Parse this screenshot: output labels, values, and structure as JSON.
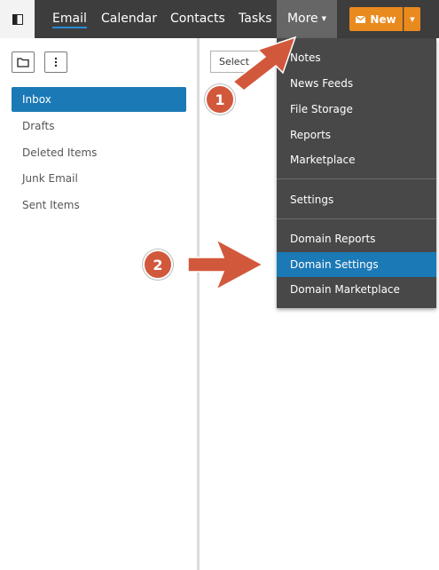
{
  "nav": {
    "email": "Email",
    "calendar": "Calendar",
    "contacts": "Contacts",
    "tasks": "Tasks",
    "more": "More",
    "new_label": "New"
  },
  "left_pane": {
    "folders": [
      "Inbox",
      "Drafts",
      "Deleted Items",
      "Junk Email",
      "Sent Items"
    ],
    "selected_folder": "Inbox"
  },
  "main": {
    "select_label": "Select"
  },
  "more_menu": {
    "items": [
      "Notes",
      "News Feeds",
      "File Storage",
      "Reports",
      "Marketplace",
      "Settings",
      "Domain Reports",
      "Domain Settings",
      "Domain Marketplace"
    ],
    "highlighted": "Domain Settings"
  },
  "annotations": {
    "step1": "1",
    "step2": "2"
  },
  "colors": {
    "topbar": "#3d3d3d",
    "accent_blue": "#1b79b6",
    "new_orange": "#e98a1e",
    "annotation_red": "#d2583c"
  },
  "icons": {
    "sidebar_toggle": "sidebar-toggle-icon",
    "folder": "folder-icon",
    "more": "vertical-dots-icon",
    "mail": "envelope-icon"
  }
}
